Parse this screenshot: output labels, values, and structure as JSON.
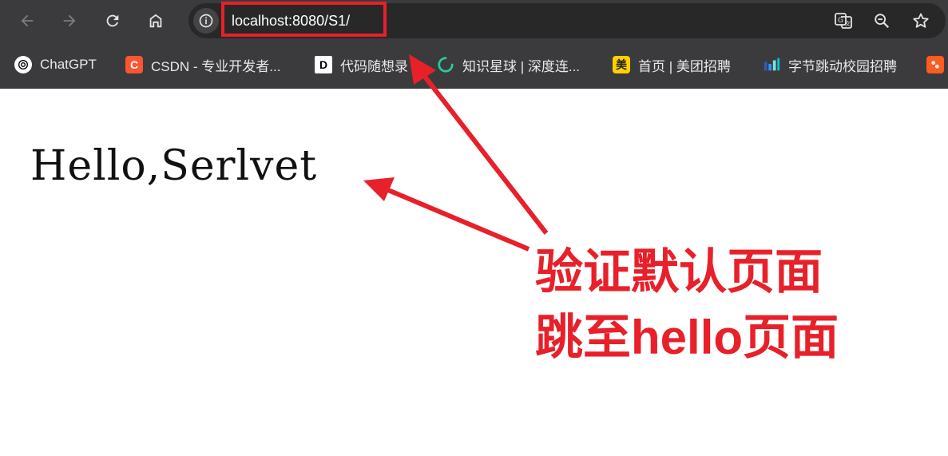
{
  "browser": {
    "url": "localhost:8080/S1/",
    "bookmarks": [
      {
        "label": "ChatGPT",
        "icon": "chatgpt-icon"
      },
      {
        "label": "CSDN - 专业开发者...",
        "icon": "csdn-icon",
        "glyph": "C"
      },
      {
        "label": "代码随想录",
        "icon": "daima-icon",
        "glyph": "D"
      },
      {
        "label": "知识星球 | 深度连...",
        "icon": "zsxq-icon"
      },
      {
        "label": "首页 | 美团招聘",
        "icon": "meituan-icon",
        "glyph": "美"
      },
      {
        "label": "字节跳动校园招聘",
        "icon": "bytedance-icon"
      }
    ]
  },
  "page": {
    "heading": "Hello,Serlvet"
  },
  "annotation": {
    "line1": "验证默认页面",
    "line2": "跳至hello页面",
    "color": "#e8202a"
  }
}
